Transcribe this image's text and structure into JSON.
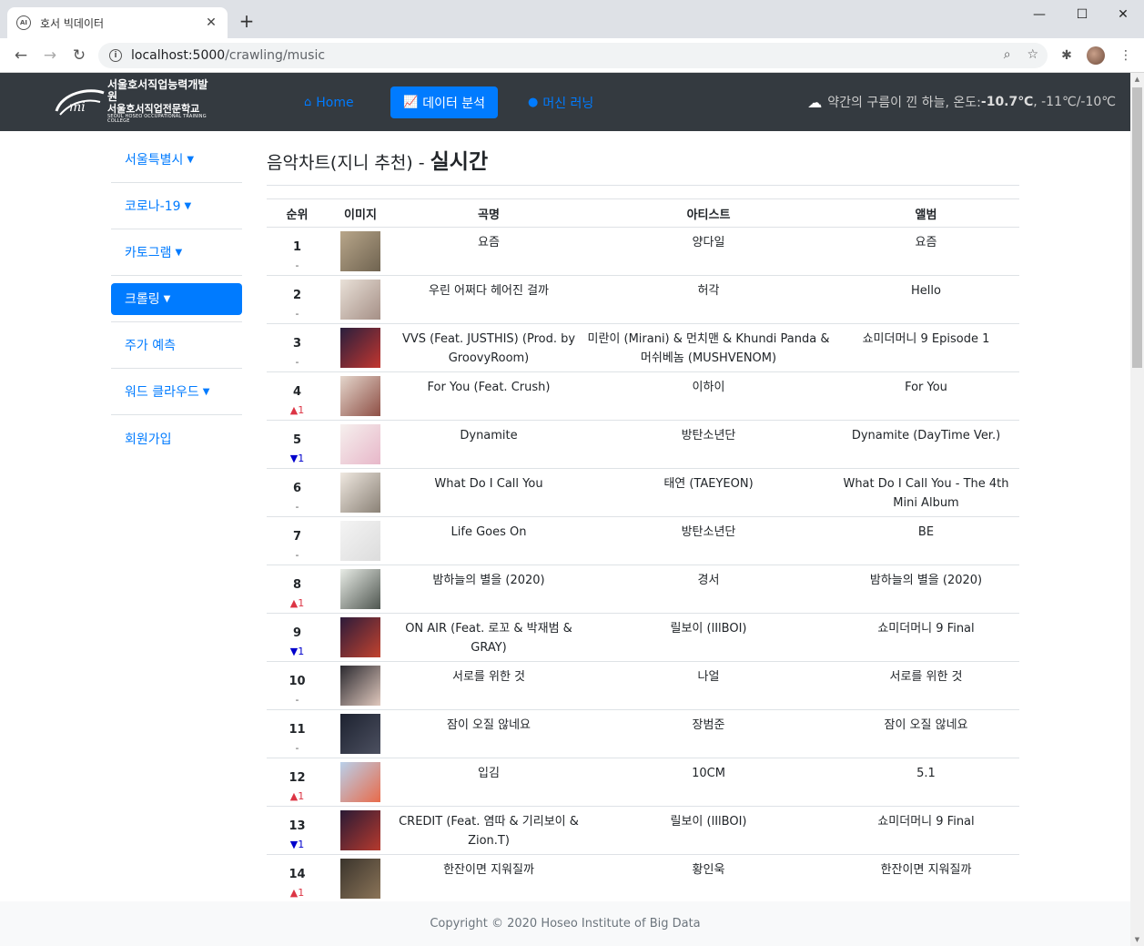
{
  "browser": {
    "tab_title": "호서 빅데이터",
    "favicon_text": "AI",
    "url_host": "localhost:5000",
    "url_path": "/crawling/music"
  },
  "navbar": {
    "logo_line1": "서울호서직업능력개발원",
    "logo_line2": "서울호서직업전문학교",
    "logo_line3": "SEOUL HOSEO OCCUPATIONAL TRAINING COLLEGE",
    "links": [
      {
        "label": "Home",
        "icon": "home-icon"
      },
      {
        "label": "데이터 분석",
        "icon": "chart-line-icon"
      },
      {
        "label": "머신 러닝",
        "icon": "brain-icon"
      }
    ],
    "weather_desc": "약간의 구름이 낀 하늘, 온도: ",
    "weather_temp": "-10.7℃",
    "weather_range": ", -11℃/-10℃"
  },
  "sidebar": {
    "items": [
      {
        "label": "서울특별시"
      },
      {
        "label": "코로나-19"
      },
      {
        "label": "카토그램"
      },
      {
        "label": "크롤링"
      },
      {
        "label": "주가 예측"
      },
      {
        "label": "워드 클라우드"
      },
      {
        "label": "회원가입"
      }
    ]
  },
  "main": {
    "title_prefix": "음악차트(지니 추천) - ",
    "title_bold": "실시간",
    "columns": [
      "순위",
      "이미지",
      "곡명",
      "아티스트",
      "앨범"
    ],
    "rows": [
      {
        "rank": "1",
        "change": "-",
        "dir": "flat",
        "title": "요즘",
        "artist": "양다일",
        "album": "요즘",
        "c1": "#b8a68a",
        "c2": "#6f6350"
      },
      {
        "rank": "2",
        "change": "-",
        "dir": "flat",
        "title": "우린 어쩌다 헤어진 걸까",
        "artist": "허각",
        "album": "Hello",
        "c1": "#e9e1d8",
        "c2": "#a58f86"
      },
      {
        "rank": "3",
        "change": "-",
        "dir": "flat",
        "title": "VVS (Feat. JUSTHIS) (Prod. by GroovyRoom)",
        "artist": "미란이 (Mirani) & 먼치맨 & Khundi Panda & 머쉬베놈 (MUSHVENOM)",
        "album": "쇼미더머니 9 Episode 1",
        "c1": "#2a1f3d",
        "c2": "#c2362f"
      },
      {
        "rank": "4",
        "change": "▲1",
        "dir": "up",
        "title": "For You (Feat. Crush)",
        "artist": "이하이",
        "album": "For You",
        "c1": "#e4d6cc",
        "c2": "#8e4f45"
      },
      {
        "rank": "5",
        "change": "▼1",
        "dir": "down",
        "title": "Dynamite",
        "artist": "방탄소년단",
        "album": "Dynamite (DayTime Ver.)",
        "c1": "#f6f0ee",
        "c2": "#e7b7c9"
      },
      {
        "rank": "6",
        "change": "-",
        "dir": "flat",
        "title": "What Do I Call You",
        "artist": "태연 (TAEYEON)",
        "album": "What Do I Call You - The 4th Mini Album",
        "c1": "#efe8e0",
        "c2": "#8a8176"
      },
      {
        "rank": "7",
        "change": "-",
        "dir": "flat",
        "title": "Life Goes On",
        "artist": "방탄소년단",
        "album": "BE",
        "c1": "#f4f4f4",
        "c2": "#dcdcdc"
      },
      {
        "rank": "8",
        "change": "▲1",
        "dir": "up",
        "title": "밤하늘의 별을 (2020)",
        "artist": "경서",
        "album": "밤하늘의 별을 (2020)",
        "c1": "#e8ece6",
        "c2": "#4f5650"
      },
      {
        "rank": "9",
        "change": "▼1",
        "dir": "down",
        "title": "ON AIR (Feat. 로꼬 & 박재범 & GRAY)",
        "artist": "릴보이 (lIlBOI)",
        "album": "쇼미더머니 9 Final",
        "c1": "#2d1b3a",
        "c2": "#c2432f"
      },
      {
        "rank": "10",
        "change": "-",
        "dir": "flat",
        "title": "서로를 위한 것",
        "artist": "나얼",
        "album": "서로를 위한 것",
        "c1": "#2b2a30",
        "c2": "#e0c8bd"
      },
      {
        "rank": "11",
        "change": "-",
        "dir": "flat",
        "title": "잠이 오질 않네요",
        "artist": "장범준",
        "album": "잠이 오질 않네요",
        "c1": "#1d2230",
        "c2": "#4c5060"
      },
      {
        "rank": "12",
        "change": "▲1",
        "dir": "up",
        "title": "입김",
        "artist": "10CM",
        "album": "5.1",
        "c1": "#b9d0ea",
        "c2": "#e86b4b"
      },
      {
        "rank": "13",
        "change": "▼1",
        "dir": "down",
        "title": "CREDIT (Feat. 염따 & 기리보이 & Zion.T)",
        "artist": "릴보이 (lIlBOI)",
        "album": "쇼미더머니 9 Final",
        "c1": "#2a1a35",
        "c2": "#b63a2e"
      },
      {
        "rank": "14",
        "change": "▲1",
        "dir": "up",
        "title": "한잔이면 지워질까",
        "artist": "황인욱",
        "album": "한잔이면 지워질까",
        "c1": "#3a342c",
        "c2": "#8b7458"
      }
    ]
  },
  "footer": {
    "text": "Copyright © 2020 Hoseo Institute of Big Data"
  },
  "colors": {
    "accent": "#007bff",
    "navbar_bg": "#343a40",
    "up": "#dc3545",
    "down": "#0000cc"
  }
}
